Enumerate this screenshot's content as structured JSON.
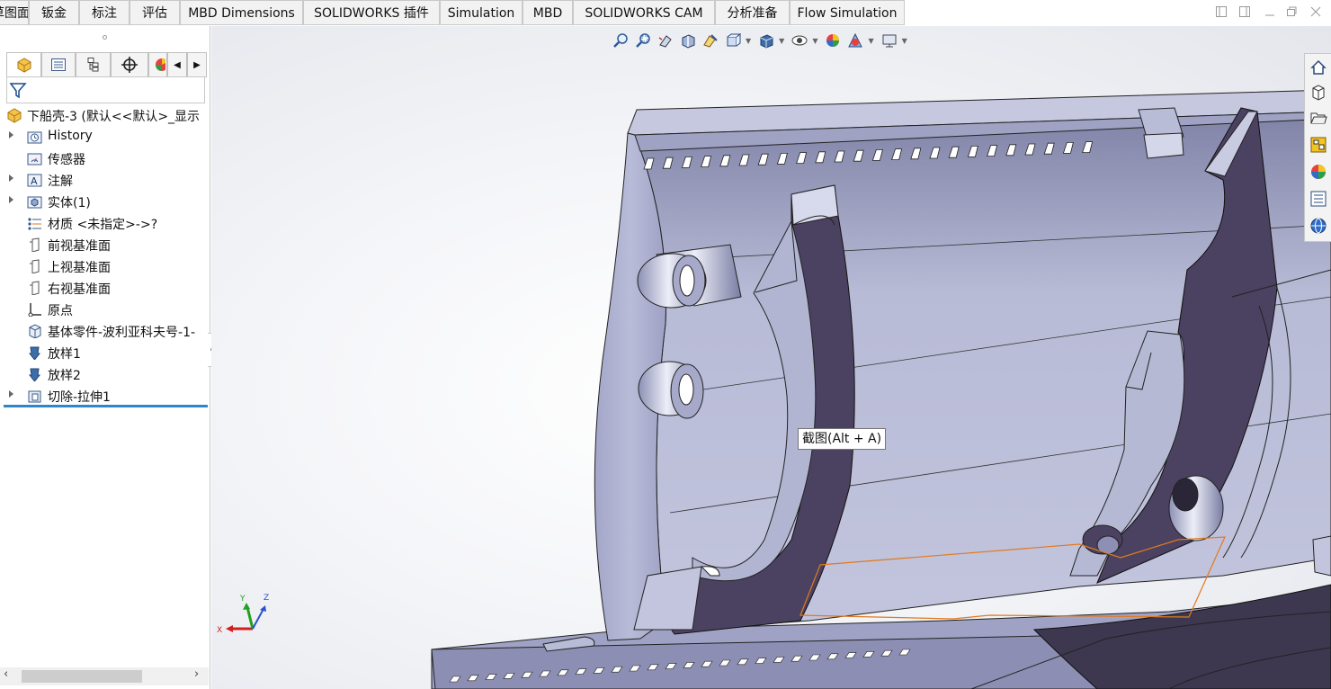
{
  "tabs": [
    "草图面",
    "钣金",
    "标注",
    "评估",
    "MBD Dimensions",
    "SOLIDWORKS 插件",
    "Simulation",
    "MBD",
    "SOLIDWORKS CAM",
    "分析准备",
    "Flow Simulation"
  ],
  "feature_tree": {
    "root": "下船壳-3 (默认<<默认>_显示",
    "items": [
      {
        "label": "History",
        "icon": "history-folder-icon",
        "expandable": true
      },
      {
        "label": "传感器",
        "icon": "sensor-folder-icon",
        "expandable": false
      },
      {
        "label": "注解",
        "icon": "annotation-folder-icon",
        "expandable": true
      },
      {
        "label": "实体(1)",
        "icon": "solid-bodies-folder-icon",
        "expandable": true
      },
      {
        "label": "材质 <未指定>->?",
        "icon": "material-icon",
        "expandable": false
      },
      {
        "label": "前视基准面",
        "icon": "plane-icon",
        "expandable": false
      },
      {
        "label": "上视基准面",
        "icon": "plane-icon",
        "expandable": false
      },
      {
        "label": "右视基准面",
        "icon": "plane-icon",
        "expandable": false
      },
      {
        "label": "原点",
        "icon": "origin-icon",
        "expandable": false
      },
      {
        "label": "基体零件-波利亚科夫号-1-",
        "icon": "base-part-icon",
        "expandable": false
      },
      {
        "label": "放样1",
        "icon": "loft-icon",
        "expandable": false
      },
      {
        "label": "放样2",
        "icon": "loft-icon",
        "expandable": false
      },
      {
        "label": "切除-拉伸1",
        "icon": "cut-extrude-icon",
        "expandable": true
      }
    ]
  },
  "panel_tabs": [
    "featuremanager-tab",
    "propertymanager-tab",
    "configurationmanager-tab",
    "dimxpert-tab",
    "display-manager-tab"
  ],
  "tooltip": "截图(Alt + A)",
  "triad": {
    "x": "X",
    "y": "Y",
    "z": "Z"
  },
  "colors": {
    "model_face": "#a9accd",
    "model_dark": "#4a3f5c",
    "accent": "#2f86c8",
    "sketch": "#e07a1f"
  }
}
